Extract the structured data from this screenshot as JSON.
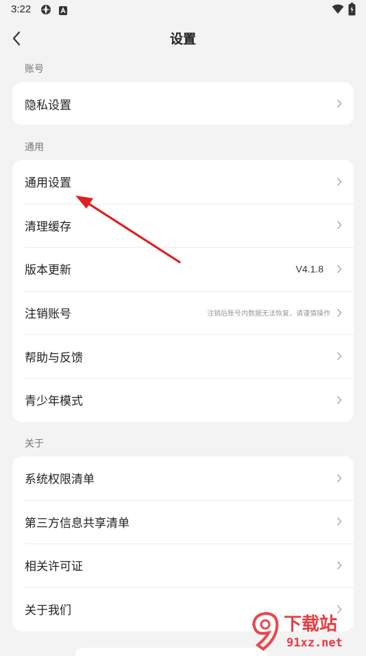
{
  "status_bar": {
    "time": "3:22",
    "icons": [
      "vpn-icon",
      "a-box-icon",
      "wifi-icon",
      "battery-icon"
    ]
  },
  "nav": {
    "title": "设置",
    "back_icon": "back-arrow-icon"
  },
  "sections": [
    {
      "label": "账号",
      "items": [
        {
          "label": "隐私设置"
        }
      ]
    },
    {
      "label": "通用",
      "items": [
        {
          "label": "通用设置"
        },
        {
          "label": "清理缓存"
        },
        {
          "label": "版本更新",
          "value": "V4.1.8"
        },
        {
          "label": "注销账号",
          "note": "注销后账号内数据无法恢复，请谨慎操作"
        },
        {
          "label": "帮助与反馈"
        },
        {
          "label": "青少年模式"
        }
      ]
    },
    {
      "label": "关于",
      "items": [
        {
          "label": "系统权限清单"
        },
        {
          "label": "第三方信息共享清单"
        },
        {
          "label": "相关许可证"
        },
        {
          "label": "关于我们"
        }
      ]
    }
  ],
  "watermark": {
    "text_cn": "下载站",
    "text_domain": "91xz.net"
  },
  "colors": {
    "background": "#f3f3f3",
    "card": "#ffffff",
    "annotation_arrow": "#e02020",
    "watermark_red": "#e8262c"
  }
}
